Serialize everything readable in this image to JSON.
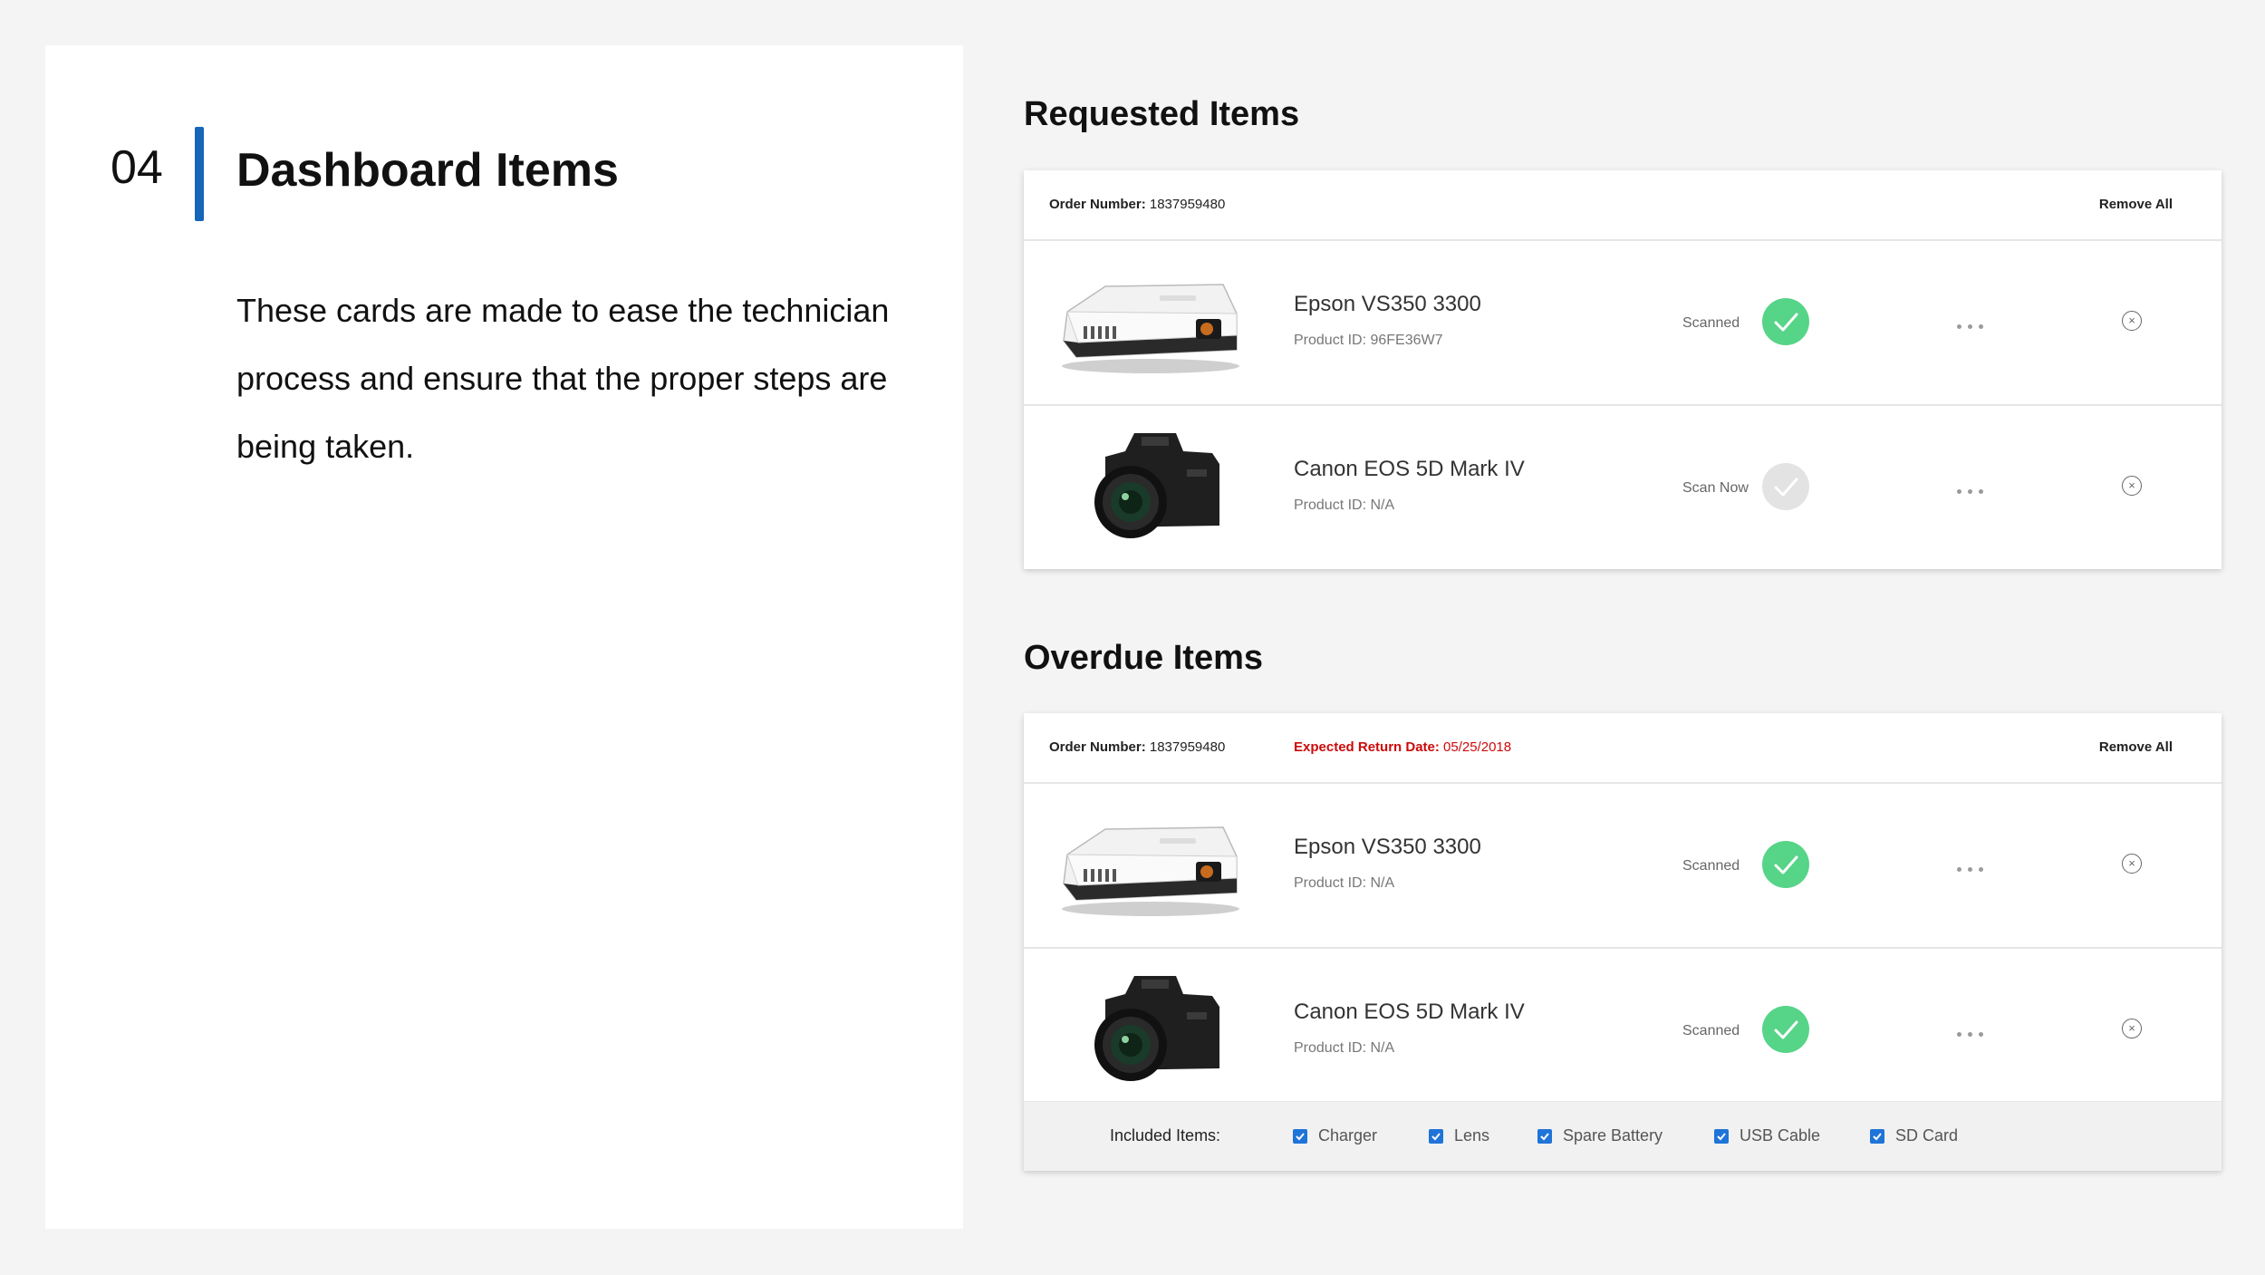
{
  "intro": {
    "number": "04",
    "title": "Dashboard Items",
    "description": "These cards are made to ease the technician process and ensure that the proper steps are being taken."
  },
  "requested": {
    "heading": "Requested Items",
    "order_label": "Order Number:",
    "order_number": "1837959480",
    "remove_all": "Remove All",
    "items": [
      {
        "name": "Epson VS350 3300",
        "product_id": "Product ID: 96FE36W7",
        "status": "Scanned",
        "state": "scanned",
        "image": "projector"
      },
      {
        "name": "Canon EOS 5D Mark IV",
        "product_id": "Product ID: N/A",
        "status": "Scan Now",
        "state": "pending",
        "image": "camera"
      }
    ]
  },
  "overdue": {
    "heading": "Overdue Items",
    "order_label": "Order Number:",
    "order_number": "1837959480",
    "return_label": "Expected Return Date:",
    "return_date": "05/25/2018",
    "remove_all": "Remove All",
    "items": [
      {
        "name": "Epson VS350 3300",
        "product_id": "Product ID: N/A",
        "status": "Scanned",
        "state": "scanned",
        "image": "projector"
      },
      {
        "name": "Canon EOS 5D Mark IV",
        "product_id": "Product ID: N/A",
        "status": "Scanned",
        "state": "scanned",
        "image": "camera"
      }
    ],
    "included_label": "Included Items:",
    "included_items": [
      "Charger",
      "Lens",
      "Spare Battery",
      "USB Cable",
      "SD Card"
    ]
  },
  "colors": {
    "accent_bar": "#1565b8",
    "scanned_green": "#56d488",
    "pending_gray": "#e3e3e3",
    "overdue_red": "#cc0a0a",
    "checkbox_blue": "#1f74d8"
  },
  "icons": {
    "scanned": "check-circle-icon",
    "more": "more-dots-icon",
    "remove": "close-circle-icon",
    "checkbox": "checkbox-checked-icon"
  }
}
